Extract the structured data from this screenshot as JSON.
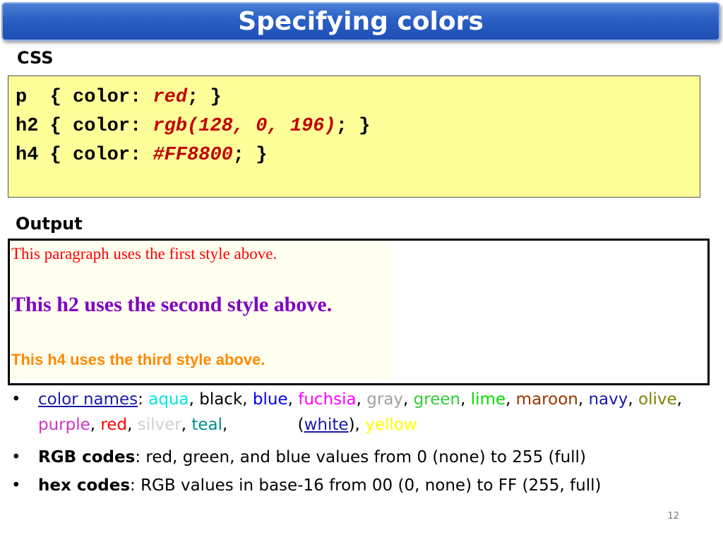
{
  "title": "Specifying colors",
  "css_label": "CSS",
  "code_lines": [
    {
      "prefix": "p  { color: ",
      "value": "red",
      "suffix": "; }"
    },
    {
      "prefix": "h2 { color: ",
      "value": "rgb(128, 0, 196)",
      "suffix": "; }"
    },
    {
      "prefix": "h4 { color: ",
      "value": "#FF8800",
      "suffix": "; }"
    }
  ],
  "output_label": "Output",
  "output": {
    "p_text": "This paragraph uses the first style above.",
    "h2_text": "This h2 uses the second style above.",
    "h4_text": "This h4 uses the third style above."
  },
  "bullet_color_names": {
    "link_text": "color names",
    "sep_colon": ": ",
    "colors": [
      {
        "name": "aqua",
        "color": "#00e5e5"
      },
      {
        "name": "black",
        "color": "#000000"
      },
      {
        "name": "blue",
        "color": "#0000ff"
      },
      {
        "name": "fuchsia",
        "color": "#ff00ff"
      },
      {
        "name": "gray",
        "color": "#a0a0a0"
      },
      {
        "name": "green",
        "color": "#33cc33"
      },
      {
        "name": "lime",
        "color": "#00dd00"
      },
      {
        "name": "maroon",
        "color": "#993300"
      },
      {
        "name": "navy",
        "color": "#1a1aa8"
      },
      {
        "name": "olive",
        "color": "#808000"
      },
      {
        "name": "purple",
        "color": "#cc33cc"
      },
      {
        "name": "red",
        "color": "#ff0000"
      },
      {
        "name": "silver",
        "color": "#d0d0d0"
      },
      {
        "name": "teal",
        "color": "#008b8b"
      }
    ],
    "white_label": "white",
    "yellow_label": "yellow",
    "yellow_color": "#ffff00"
  },
  "bullet_rgb": {
    "bold": "RGB codes",
    "text": ": red, green, and blue values from 0 (none) to 255 (full)"
  },
  "bullet_hex": {
    "bold": "hex codes",
    "text": ": RGB values in base-16 from 00 (0, none) to FF (255, full)"
  },
  "bullet_glyph": "•",
  "page_number": "12"
}
